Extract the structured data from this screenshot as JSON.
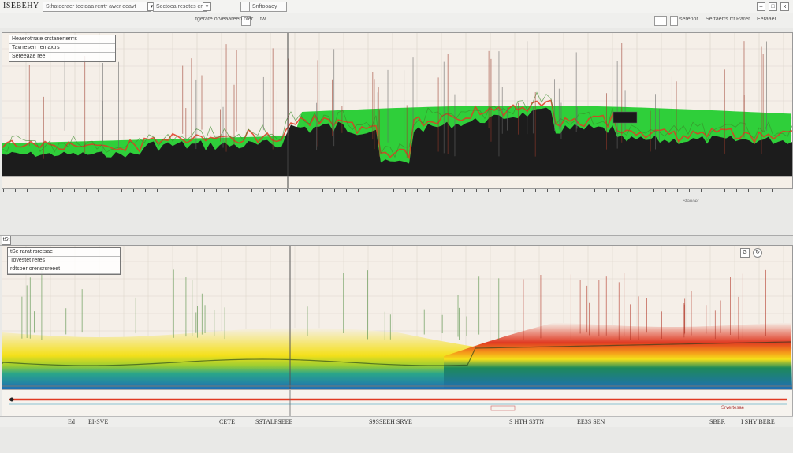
{
  "window": {
    "title": "ISEBEHY",
    "menu_box_1": "Sthatocraer tectoaa rerrtr awer eeavt",
    "menu_box_2": "Sectoea resotes emtt",
    "menu_box_3": "Snftooaoy",
    "close_label": "x"
  },
  "toolbar": {
    "left_text": "tgerate orveaareen nter",
    "mid_text": "tw...",
    "right_text_1": "serenor",
    "right_text_2": "Sertaerrs rrr",
    "right_text_3": "Rarer",
    "right_text_4": "Eeraaer"
  },
  "panel1": {
    "overlay_rows": [
      "Heaerotrrate crstanerterrrs",
      "Tavrreserr remaxtrs",
      "Sereeaae ree"
    ],
    "zoom_label": "Starioet"
  },
  "panel2": {
    "tab_label": "tSt",
    "overlay_rows": [
      "tSe rarat rsretsae",
      "Tovestet reres",
      "rdtsoer orensrsreeet"
    ],
    "corner_label": "G"
  },
  "axis": {
    "bottom_note": "Srvertesae"
  },
  "statusbar": {
    "items": [
      "Ed",
      "EI-SVE",
      "CETE",
      "SSTALFSEEE",
      "S9SSEEH SRYE",
      "S HTH S3TN",
      "EE3S SEN",
      "SBER",
      "I  SHY BERE"
    ]
  },
  "colors": {
    "green": "#2fcf3a",
    "red": "#e03a22",
    "yellow": "#f5e01a",
    "blue": "#1f6fb5",
    "dark": "#1c1c1c"
  }
}
